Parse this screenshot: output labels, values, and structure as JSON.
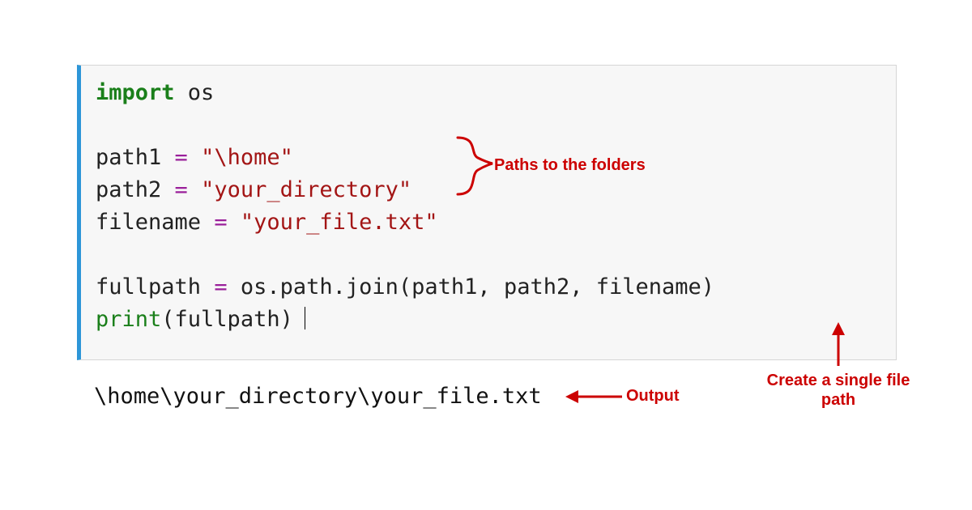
{
  "code": {
    "l1_kw": "import",
    "l1_mod": " os",
    "l3_var": "path1 ",
    "l3_op": "=",
    "l3_str": " \"\\home\"",
    "l4_var": "path2 ",
    "l4_op": "=",
    "l4_str": " \"your_directory\"",
    "l5_var": "filename ",
    "l5_op": "=",
    "l5_str": " \"your_file.txt\"",
    "l7_var": "fullpath ",
    "l7_op": "=",
    "l7_rest": " os.path.join(path1, path2, filename)",
    "l8_fn": "print",
    "l8_rest": "(fullpath)"
  },
  "output": "\\home\\your_directory\\your_file.txt",
  "annotations": {
    "paths": "Paths to the folders",
    "create_l1": "Create a single file",
    "create_l2": "path",
    "output": "Output"
  },
  "colors": {
    "keyword": "#1a7f1a",
    "operator": "#9a1f9a",
    "string": "#a31515",
    "annot": "#cc0000",
    "border_accent": "#2d96d8"
  }
}
